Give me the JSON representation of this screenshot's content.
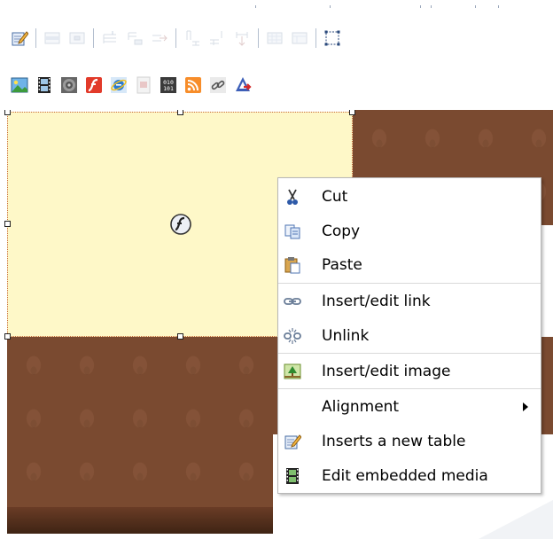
{
  "toolbar": {
    "row1": [
      {
        "name": "edit-css-style-button",
        "icon": "pencil-page-icon",
        "enabled": true
      },
      {
        "name": "table-row-props-button",
        "icon": "table-row-icon",
        "enabled": false
      },
      {
        "name": "table-cell-props-button",
        "icon": "table-cell-icon",
        "enabled": false
      },
      {
        "name": "insert-row-before-button",
        "icon": "row-before-icon",
        "enabled": false
      },
      {
        "name": "insert-row-after-button",
        "icon": "row-after-icon",
        "enabled": false
      },
      {
        "name": "delete-row-button",
        "icon": "delete-row-icon",
        "enabled": false
      },
      {
        "name": "insert-col-before-button",
        "icon": "col-before-icon",
        "enabled": false
      },
      {
        "name": "insert-col-after-button",
        "icon": "col-after-icon",
        "enabled": false
      },
      {
        "name": "delete-col-button",
        "icon": "delete-col-icon",
        "enabled": false
      },
      {
        "name": "split-cells-button",
        "icon": "split-cells-icon",
        "enabled": false
      },
      {
        "name": "merge-cells-button",
        "icon": "merge-cells-icon",
        "enabled": false
      },
      {
        "name": "visual-aid-button",
        "icon": "visual-aid-icon",
        "enabled": true
      }
    ],
    "row2": [
      {
        "name": "insert-image-button",
        "icon": "image-icon"
      },
      {
        "name": "insert-video-button",
        "icon": "film-icon"
      },
      {
        "name": "insert-audio-button",
        "icon": "speaker-icon"
      },
      {
        "name": "insert-flash-button",
        "icon": "flash-icon"
      },
      {
        "name": "insert-ie-button",
        "icon": "ie-icon"
      },
      {
        "name": "insert-document-button",
        "icon": "document-icon"
      },
      {
        "name": "insert-binary-button",
        "icon": "binary-icon"
      },
      {
        "name": "insert-rss-button",
        "icon": "rss-icon"
      },
      {
        "name": "insert-link-button",
        "icon": "chain-link-icon"
      },
      {
        "name": "insert-anchor-button",
        "icon": "anchor-icon"
      }
    ]
  },
  "context_menu": {
    "items": [
      {
        "label": "Cut",
        "icon": "scissors-icon"
      },
      {
        "label": "Copy",
        "icon": "copy-icon"
      },
      {
        "label": "Paste",
        "icon": "paste-icon"
      },
      {
        "label": "Insert/edit link",
        "icon": "link-icon"
      },
      {
        "label": "Unlink",
        "icon": "unlink-icon"
      },
      {
        "label": "Insert/edit image",
        "icon": "image-icon"
      },
      {
        "label": "Alignment",
        "icon": "",
        "submenu": true
      },
      {
        "label": "Inserts a new table",
        "icon": "table-edit-icon"
      },
      {
        "label": "Edit embedded media",
        "icon": "film-icon"
      }
    ]
  },
  "colors": {
    "placeholder_bg": "#fef8c8",
    "placeholder_border": "#c86a3a",
    "wood": "#7a4a30",
    "menu_border": "#b7b7b7",
    "separator": "#d9d9d9"
  }
}
